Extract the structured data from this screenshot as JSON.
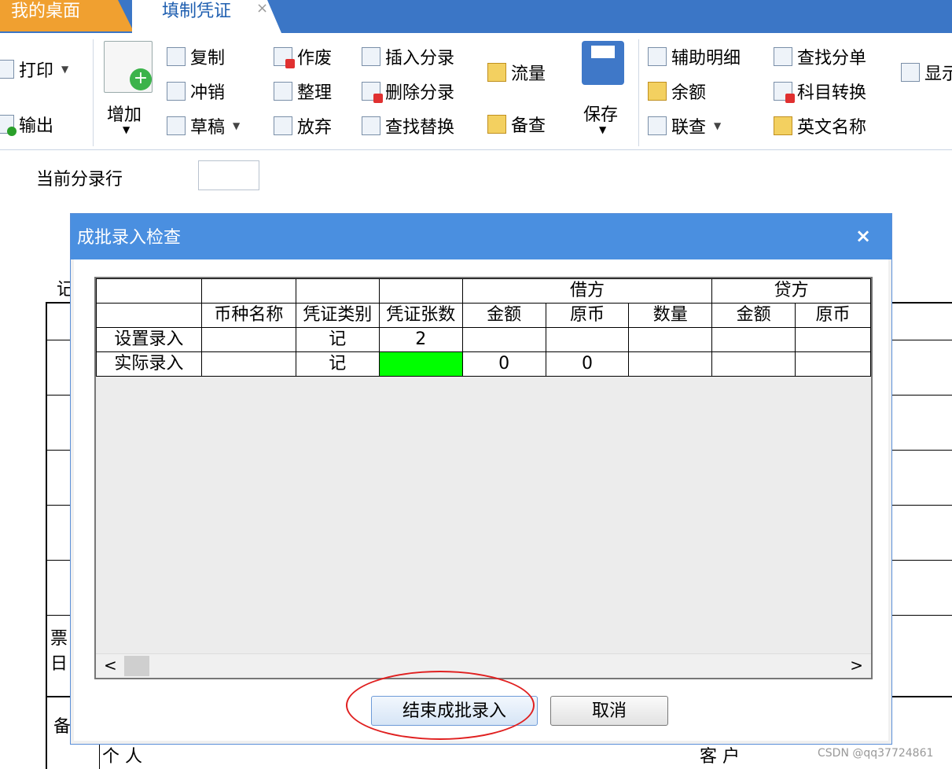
{
  "tabs": {
    "desk": "我的桌面",
    "active": "填制凭证",
    "close": "×"
  },
  "toolbar": {
    "print": "打印",
    "export": "输出",
    "add": "增加",
    "copy": "复制",
    "reverse": "冲销",
    "draft": "草稿",
    "void": "作废",
    "tidy": "整理",
    "abandon": "放弃",
    "insert_entry": "插入分录",
    "delete_entry": "删除分录",
    "find_replace": "查找替换",
    "flow": "流量",
    "check": "备查",
    "save": "保存",
    "aux_detail": "辅助明细",
    "balance": "余额",
    "joint_query": "联查",
    "find_split": "查找分单",
    "subject_convert": "科目转换",
    "english_name": "英文名称",
    "display": "显示"
  },
  "current_entry": {
    "label": "当前分录行",
    "value": ""
  },
  "background": {
    "left_chars": [
      "记",
      "票",
      "日",
      "备"
    ],
    "person": "个  人",
    "customer": "客  户"
  },
  "dialog": {
    "title": "成批录入检查",
    "close": "×",
    "group_headers": {
      "debit": "借方",
      "credit": "贷方"
    },
    "columns": [
      "",
      "币种名称",
      "凭证类别",
      "凭证张数",
      "金额",
      "原币",
      "数量",
      "金额",
      "原币"
    ],
    "rows": [
      {
        "label": "设置录入",
        "currency": "",
        "category": "记",
        "count": "2",
        "debit_amount": "",
        "debit_orig": "",
        "debit_qty": "",
        "credit_amount": "",
        "credit_orig": ""
      },
      {
        "label": "实际录入",
        "currency": "",
        "category": "记",
        "count": "",
        "debit_amount": "0",
        "debit_orig": "0",
        "debit_qty": "",
        "credit_amount": "",
        "credit_orig": ""
      }
    ],
    "scroll_left": "<",
    "scroll_right": ">",
    "buttons": {
      "end": "结束成批录入",
      "cancel": "取消"
    }
  },
  "watermark": "CSDN @qq37724861"
}
